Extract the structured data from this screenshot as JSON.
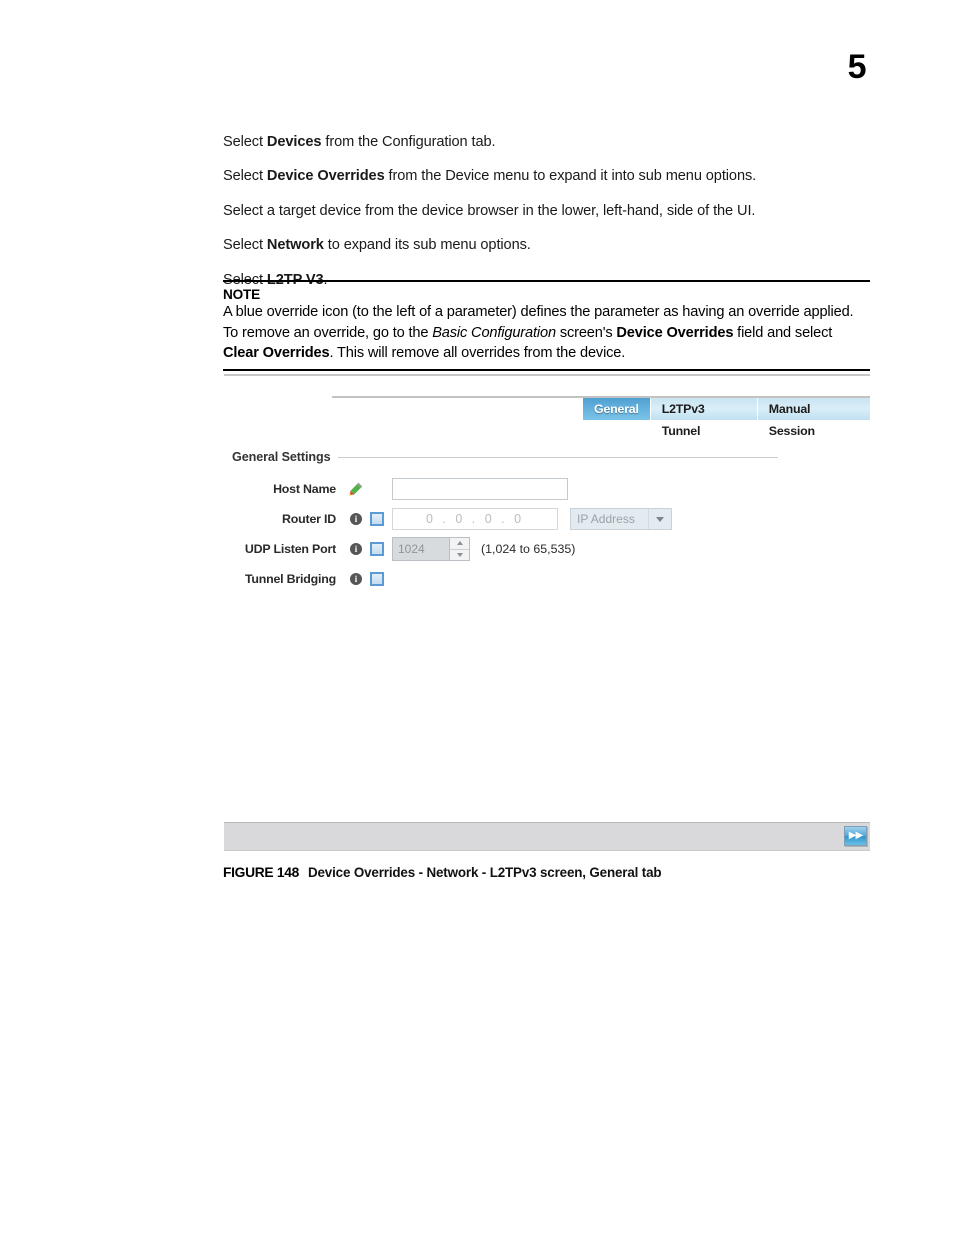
{
  "page": {
    "number": "5"
  },
  "steps": [
    {
      "pre": "Select ",
      "bold": "Devices",
      "post": " from the Configuration tab."
    },
    {
      "pre": "Select ",
      "bold": "Device Overrides",
      "post": " from the Device menu to expand it into sub menu options."
    },
    {
      "pre": "Select a target device from the device browser in the lower, left-hand, side of the UI.",
      "bold": "",
      "post": ""
    },
    {
      "pre": "Select ",
      "bold": "Network",
      "post": " to expand its sub menu options."
    },
    {
      "pre": "Select ",
      "bold": "L2TP V3",
      "post": "."
    }
  ],
  "note": {
    "title": "NOTE",
    "line1_a": "A blue override icon (to the left of a parameter) defines the parameter as having an override applied.",
    "line2_a": "To remove an override, go to the ",
    "line2_i": "Basic Configuration",
    "line2_b": " screen's ",
    "line2_c": "Device Overrides",
    "line2_d": " field and select ",
    "line2_e": "Clear Overrides",
    "line2_f": ". This will remove all overrides from the device."
  },
  "screen": {
    "tabs": [
      {
        "label": "General",
        "active": true
      },
      {
        "label": "L2TPv3 Tunnel",
        "active": false
      },
      {
        "label": "Manual Session",
        "active": false
      }
    ],
    "section": {
      "title": "General Settings"
    },
    "fields": [
      {
        "label": "Host Name",
        "icon": "pencil-override-icon",
        "value": "",
        "placeholder": ""
      },
      {
        "label": "Router ID",
        "icon": "info-icon",
        "value": "0 . 0 . 0 . 0",
        "dropdown_value": "IP Address"
      },
      {
        "label": "UDP Listen Port",
        "icon": "info-icon",
        "value": "1024",
        "hint": "(1,024 to 65,535)"
      },
      {
        "label": "Tunnel Bridging",
        "icon": "info-icon"
      }
    ],
    "bottombar": {
      "next_glyph": "▶▶"
    }
  },
  "figure": {
    "label": "FIGURE 148",
    "caption": "Device Overrides - Network - L2TPv3 screen, General tab"
  },
  "colors": {
    "tab_active": "#62b1dd",
    "tab_inactive": "#d9eef8",
    "override_blue": "#5b9bd5",
    "bottombar_gray": "#d9d9db"
  }
}
